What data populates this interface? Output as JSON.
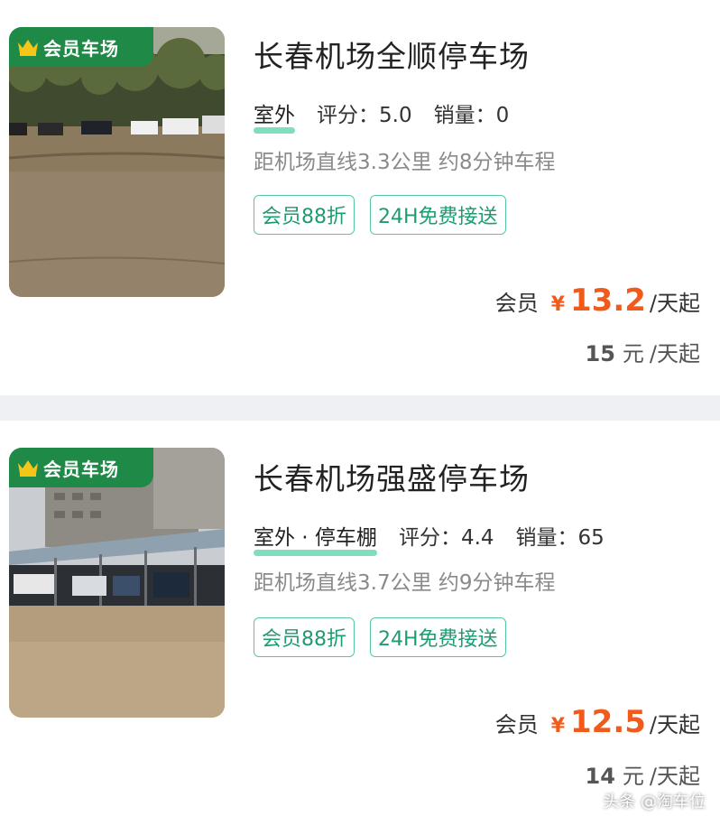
{
  "listings": [
    {
      "badge": "会员车场",
      "name": "长春机场全顺停车场",
      "type_tag": "室外",
      "rating_label": "评分：5.0",
      "sales_label": "销量：0",
      "distance": "距机场直线3.3公里 约8分钟车程",
      "chips": [
        "会员88折",
        "24H免费接送"
      ],
      "member_label": "会员",
      "currency": "¥",
      "member_price": "13.2",
      "per_day": "/天起",
      "orig_price": "15",
      "orig_currency": "元",
      "orig_per_day": "/天起"
    },
    {
      "badge": "会员车场",
      "name": "长春机场强盛停车场",
      "type_tag": "室外 · 停车棚",
      "rating_label": "评分：4.4",
      "sales_label": "销量：65",
      "distance": "距机场直线3.7公里 约9分钟车程",
      "chips": [
        "会员88折",
        "24H免费接送"
      ],
      "member_label": "会员",
      "currency": "¥",
      "member_price": "12.5",
      "per_day": "/天起",
      "orig_price": "14",
      "orig_currency": "元",
      "orig_per_day": "/天起"
    }
  ],
  "watermark": "头条 @淘车位",
  "colors": {
    "badge_green": "#1f8a48",
    "chip_border": "#56c7a5",
    "chip_text": "#1e9b74",
    "price_orange": "#f05a1a",
    "underline_teal": "#47d0a3"
  },
  "icons": {
    "badge_icon": "crown-icon"
  }
}
